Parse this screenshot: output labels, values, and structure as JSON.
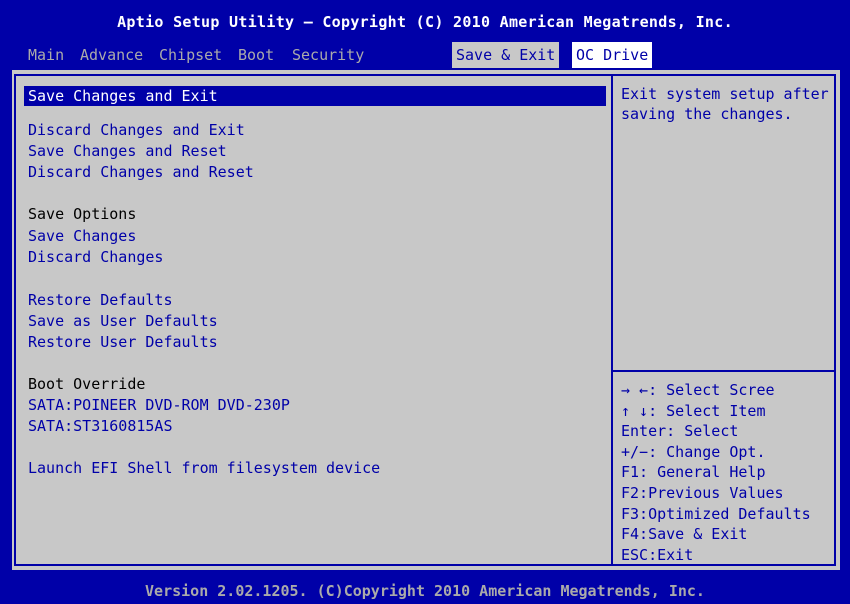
{
  "window_title": "Aptio Setup Utility – Copyright (C) 2010 American Megatrends, Inc.",
  "tabs": [
    {
      "label": "Main"
    },
    {
      "label": "Advance"
    },
    {
      "label": "Chipset"
    },
    {
      "label": "Boot"
    },
    {
      "label": "Security"
    },
    {
      "label": "Save & Exit"
    },
    {
      "label": "OC Drive"
    }
  ],
  "active_tab": "Save & Exit",
  "menu": {
    "save_changes_and_exit": "Save Changes and Exit",
    "discard_changes_and_exit": "Discard Changes and Exit",
    "save_changes_and_reset": "Save Changes and Reset",
    "discard_changes_and_reset": "Discard Changes and Reset",
    "save_options_heading": "Save Options",
    "save_changes": "Save Changes",
    "discard_changes": "Discard Changes",
    "restore_defaults": "Restore Defaults",
    "save_as_user_defaults": "Save as User Defaults",
    "restore_user_defaults": "Restore User Defaults",
    "boot_override_heading": "Boot Override",
    "boot_device_1": "SATA:POINEER DVD-ROM DVD-230P",
    "boot_device_2": "SATA:ST3160815AS",
    "launch_efi_shell": "Launch EFI Shell from filesystem device"
  },
  "help_text": "Exit system setup after saving the changes.",
  "key_help": [
    "→ ←:  Select Scree",
    "↑ ↓:  Select Item",
    "Enter: Select",
    "+/−:  Change Opt.",
    "F1: General Help",
    "F2:Previous Values",
    "F3:Optimized Defaults",
    "F4:Save & Exit",
    "ESC:Exit"
  ],
  "footer": "Version 2.02.1205. (C)Copyright 2010 American Megatrends, Inc.",
  "colors": {
    "background_blue": "#0000a8",
    "panel_gray": "#c8c8c8",
    "text_white": "#ffffff",
    "tab_text": "#aaaaaa"
  }
}
